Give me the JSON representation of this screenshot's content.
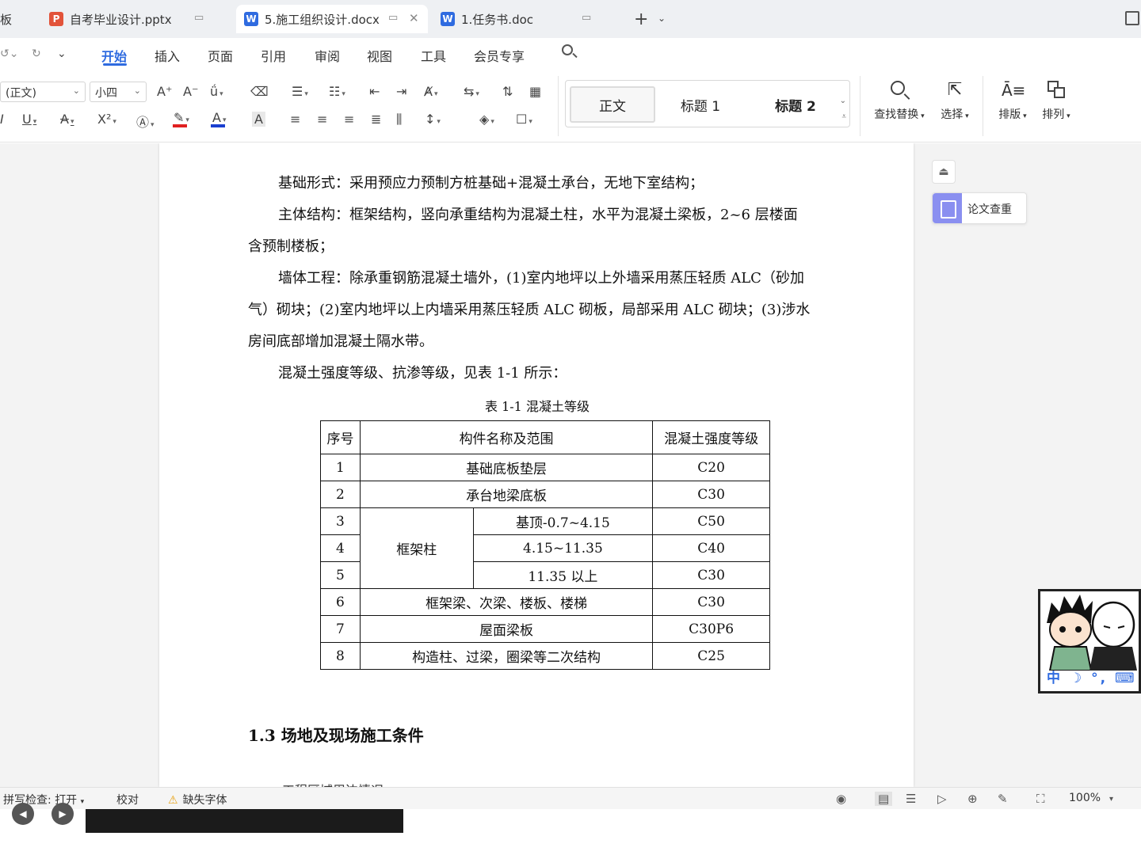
{
  "tabs": [
    {
      "label": "板",
      "app": ""
    },
    {
      "label": "自考毕业设计.pptx",
      "app": "P"
    },
    {
      "label": "5.施工组织设计.docx",
      "app": "W",
      "active": true
    },
    {
      "label": "1.任务书.doc",
      "app": "W"
    }
  ],
  "menu": {
    "items": [
      "开始",
      "插入",
      "页面",
      "引用",
      "审阅",
      "视图",
      "工具",
      "会员专享"
    ],
    "active": "开始"
  },
  "ribbon": {
    "font_name": "(正文)",
    "font_size": "小四",
    "styles": [
      "正文",
      "标题 1",
      "标题 2"
    ],
    "find_replace": "查找替换",
    "select": "选择",
    "layout": "排版",
    "arrange": "排列"
  },
  "document": {
    "paragraphs": [
      "基础形式：采用预应力预制方桩基础+混凝土承台，无地下室结构；",
      "主体结构：框架结构，竖向承重结构为混凝土柱，水平为混凝土梁板，2~6 层楼面",
      "含预制楼板；",
      "墙体工程：除承重钢筋混凝土墙外，(1)室内地坪以上外墙采用蒸压轻质 ALC（砂加",
      "气）砌块；(2)室内地坪以上内墙采用蒸压轻质 ALC 砌板，局部采用 ALC 砌块；(3)涉水",
      "房间底部增加混凝土隔水带。",
      "混凝土强度等级、抗渗等级，见表 1-1 所示："
    ],
    "table_caption": "表 1-1 混凝土等级",
    "table": {
      "headers": [
        "序号",
        "构件名称及范围",
        "混凝土强度等级"
      ],
      "rows": [
        {
          "no": "1",
          "name": "基础底板垫层",
          "grade": "C20"
        },
        {
          "no": "2",
          "name": "承台地梁底板",
          "grade": "C30"
        },
        {
          "no": "3",
          "group": "框架柱",
          "name": "基顶-0.7~4.15",
          "grade": "C50"
        },
        {
          "no": "4",
          "name": "4.15~11.35",
          "grade": "C40"
        },
        {
          "no": "5",
          "name": "11.35 以上",
          "grade": "C30"
        },
        {
          "no": "6",
          "name": "框架梁、次梁、楼板、楼梯",
          "grade": "C30"
        },
        {
          "no": "7",
          "name": "屋面梁板",
          "grade": "C30P6"
        },
        {
          "no": "8",
          "name": "构造柱、过梁，圈梁等二次结构",
          "grade": "C25"
        }
      ]
    },
    "section_heading": "1.3 场地及现场施工条件",
    "cut_text": "工程区域周边情况"
  },
  "side_panel": {
    "check_label": "论文查重"
  },
  "avatar": {
    "ime_text": "中 ☽ °, ⌨"
  },
  "status": {
    "spell_check": "拼写检查: 打开",
    "proofread": "校对",
    "missing_font": "缺失字体",
    "zoom": "100%"
  },
  "colors": {
    "accent": "#2f6be0",
    "ppt_icon": "#e2533a",
    "word_icon": "#2f6be0",
    "warning": "#e8a317",
    "highlight_red": "#e02020",
    "font_blue": "#1a3fd0"
  }
}
